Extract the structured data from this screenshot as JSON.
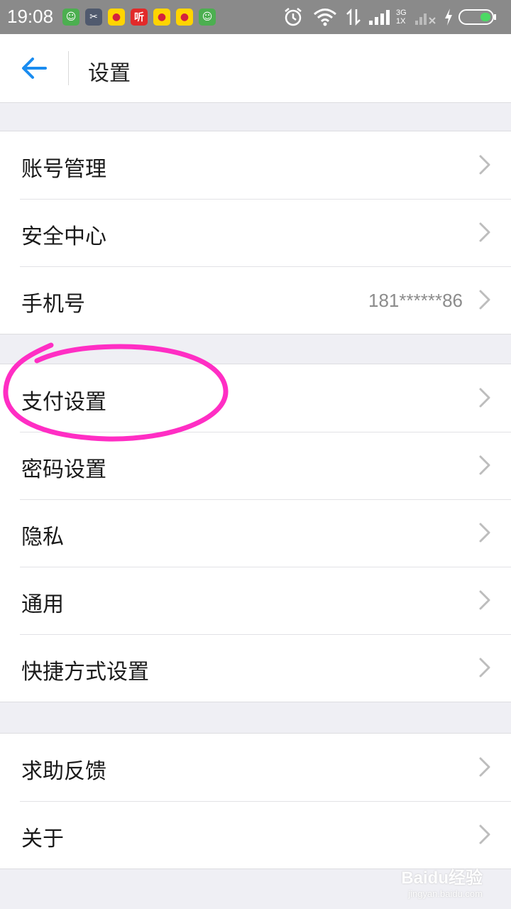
{
  "status_bar": {
    "time": "19:08",
    "notifications": [
      {
        "icon": "app-green-icon",
        "color": "#4caf50",
        "glyph": "☺"
      },
      {
        "icon": "app-scissors-icon",
        "color": "#505a6e",
        "glyph": "✂"
      },
      {
        "icon": "weibo-icon",
        "color": "#ffd400",
        "glyph": "●"
      },
      {
        "icon": "ting-icon",
        "color": "#e22a2a",
        "glyph": "听"
      },
      {
        "icon": "weibo-icon",
        "color": "#ffd400",
        "glyph": "●"
      },
      {
        "icon": "weibo-icon",
        "color": "#ffd400",
        "glyph": "●"
      },
      {
        "icon": "app-green-icon",
        "color": "#4caf50",
        "glyph": "☺"
      }
    ],
    "network_top": "3G",
    "network_bottom": "1X"
  },
  "header": {
    "title": "设置",
    "accent": "#1a8cf0"
  },
  "groups": [
    {
      "items": [
        {
          "label": "账号管理",
          "value": ""
        },
        {
          "label": "安全中心",
          "value": ""
        },
        {
          "label": "手机号",
          "value": "181******86"
        }
      ]
    },
    {
      "items": [
        {
          "label": "支付设置",
          "value": ""
        },
        {
          "label": "密码设置",
          "value": ""
        },
        {
          "label": "隐私",
          "value": ""
        },
        {
          "label": "通用",
          "value": ""
        },
        {
          "label": "快捷方式设置",
          "value": ""
        }
      ]
    },
    {
      "items": [
        {
          "label": "求助反馈",
          "value": ""
        },
        {
          "label": "关于",
          "value": ""
        }
      ]
    }
  ],
  "watermark": {
    "main": "Baidu经验",
    "sub": "jingyan.baidu.com"
  },
  "annotation_color": "#ff2ec4"
}
